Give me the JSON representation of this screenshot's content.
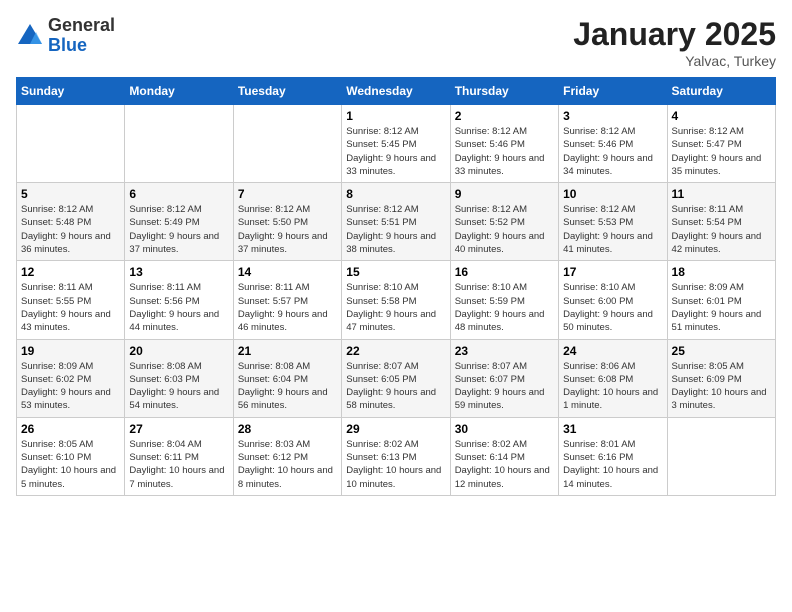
{
  "logo": {
    "general": "General",
    "blue": "Blue"
  },
  "header": {
    "month": "January 2025",
    "location": "Yalvac, Turkey"
  },
  "days_of_week": [
    "Sunday",
    "Monday",
    "Tuesday",
    "Wednesday",
    "Thursday",
    "Friday",
    "Saturday"
  ],
  "weeks": [
    [
      {
        "day": "",
        "sunrise": "",
        "sunset": "",
        "daylight": ""
      },
      {
        "day": "",
        "sunrise": "",
        "sunset": "",
        "daylight": ""
      },
      {
        "day": "",
        "sunrise": "",
        "sunset": "",
        "daylight": ""
      },
      {
        "day": "1",
        "sunrise": "Sunrise: 8:12 AM",
        "sunset": "Sunset: 5:45 PM",
        "daylight": "Daylight: 9 hours and 33 minutes."
      },
      {
        "day": "2",
        "sunrise": "Sunrise: 8:12 AM",
        "sunset": "Sunset: 5:46 PM",
        "daylight": "Daylight: 9 hours and 33 minutes."
      },
      {
        "day": "3",
        "sunrise": "Sunrise: 8:12 AM",
        "sunset": "Sunset: 5:46 PM",
        "daylight": "Daylight: 9 hours and 34 minutes."
      },
      {
        "day": "4",
        "sunrise": "Sunrise: 8:12 AM",
        "sunset": "Sunset: 5:47 PM",
        "daylight": "Daylight: 9 hours and 35 minutes."
      }
    ],
    [
      {
        "day": "5",
        "sunrise": "Sunrise: 8:12 AM",
        "sunset": "Sunset: 5:48 PM",
        "daylight": "Daylight: 9 hours and 36 minutes."
      },
      {
        "day": "6",
        "sunrise": "Sunrise: 8:12 AM",
        "sunset": "Sunset: 5:49 PM",
        "daylight": "Daylight: 9 hours and 37 minutes."
      },
      {
        "day": "7",
        "sunrise": "Sunrise: 8:12 AM",
        "sunset": "Sunset: 5:50 PM",
        "daylight": "Daylight: 9 hours and 37 minutes."
      },
      {
        "day": "8",
        "sunrise": "Sunrise: 8:12 AM",
        "sunset": "Sunset: 5:51 PM",
        "daylight": "Daylight: 9 hours and 38 minutes."
      },
      {
        "day": "9",
        "sunrise": "Sunrise: 8:12 AM",
        "sunset": "Sunset: 5:52 PM",
        "daylight": "Daylight: 9 hours and 40 minutes."
      },
      {
        "day": "10",
        "sunrise": "Sunrise: 8:12 AM",
        "sunset": "Sunset: 5:53 PM",
        "daylight": "Daylight: 9 hours and 41 minutes."
      },
      {
        "day": "11",
        "sunrise": "Sunrise: 8:11 AM",
        "sunset": "Sunset: 5:54 PM",
        "daylight": "Daylight: 9 hours and 42 minutes."
      }
    ],
    [
      {
        "day": "12",
        "sunrise": "Sunrise: 8:11 AM",
        "sunset": "Sunset: 5:55 PM",
        "daylight": "Daylight: 9 hours and 43 minutes."
      },
      {
        "day": "13",
        "sunrise": "Sunrise: 8:11 AM",
        "sunset": "Sunset: 5:56 PM",
        "daylight": "Daylight: 9 hours and 44 minutes."
      },
      {
        "day": "14",
        "sunrise": "Sunrise: 8:11 AM",
        "sunset": "Sunset: 5:57 PM",
        "daylight": "Daylight: 9 hours and 46 minutes."
      },
      {
        "day": "15",
        "sunrise": "Sunrise: 8:10 AM",
        "sunset": "Sunset: 5:58 PM",
        "daylight": "Daylight: 9 hours and 47 minutes."
      },
      {
        "day": "16",
        "sunrise": "Sunrise: 8:10 AM",
        "sunset": "Sunset: 5:59 PM",
        "daylight": "Daylight: 9 hours and 48 minutes."
      },
      {
        "day": "17",
        "sunrise": "Sunrise: 8:10 AM",
        "sunset": "Sunset: 6:00 PM",
        "daylight": "Daylight: 9 hours and 50 minutes."
      },
      {
        "day": "18",
        "sunrise": "Sunrise: 8:09 AM",
        "sunset": "Sunset: 6:01 PM",
        "daylight": "Daylight: 9 hours and 51 minutes."
      }
    ],
    [
      {
        "day": "19",
        "sunrise": "Sunrise: 8:09 AM",
        "sunset": "Sunset: 6:02 PM",
        "daylight": "Daylight: 9 hours and 53 minutes."
      },
      {
        "day": "20",
        "sunrise": "Sunrise: 8:08 AM",
        "sunset": "Sunset: 6:03 PM",
        "daylight": "Daylight: 9 hours and 54 minutes."
      },
      {
        "day": "21",
        "sunrise": "Sunrise: 8:08 AM",
        "sunset": "Sunset: 6:04 PM",
        "daylight": "Daylight: 9 hours and 56 minutes."
      },
      {
        "day": "22",
        "sunrise": "Sunrise: 8:07 AM",
        "sunset": "Sunset: 6:05 PM",
        "daylight": "Daylight: 9 hours and 58 minutes."
      },
      {
        "day": "23",
        "sunrise": "Sunrise: 8:07 AM",
        "sunset": "Sunset: 6:07 PM",
        "daylight": "Daylight: 9 hours and 59 minutes."
      },
      {
        "day": "24",
        "sunrise": "Sunrise: 8:06 AM",
        "sunset": "Sunset: 6:08 PM",
        "daylight": "Daylight: 10 hours and 1 minute."
      },
      {
        "day": "25",
        "sunrise": "Sunrise: 8:05 AM",
        "sunset": "Sunset: 6:09 PM",
        "daylight": "Daylight: 10 hours and 3 minutes."
      }
    ],
    [
      {
        "day": "26",
        "sunrise": "Sunrise: 8:05 AM",
        "sunset": "Sunset: 6:10 PM",
        "daylight": "Daylight: 10 hours and 5 minutes."
      },
      {
        "day": "27",
        "sunrise": "Sunrise: 8:04 AM",
        "sunset": "Sunset: 6:11 PM",
        "daylight": "Daylight: 10 hours and 7 minutes."
      },
      {
        "day": "28",
        "sunrise": "Sunrise: 8:03 AM",
        "sunset": "Sunset: 6:12 PM",
        "daylight": "Daylight: 10 hours and 8 minutes."
      },
      {
        "day": "29",
        "sunrise": "Sunrise: 8:02 AM",
        "sunset": "Sunset: 6:13 PM",
        "daylight": "Daylight: 10 hours and 10 minutes."
      },
      {
        "day": "30",
        "sunrise": "Sunrise: 8:02 AM",
        "sunset": "Sunset: 6:14 PM",
        "daylight": "Daylight: 10 hours and 12 minutes."
      },
      {
        "day": "31",
        "sunrise": "Sunrise: 8:01 AM",
        "sunset": "Sunset: 6:16 PM",
        "daylight": "Daylight: 10 hours and 14 minutes."
      },
      {
        "day": "",
        "sunrise": "",
        "sunset": "",
        "daylight": ""
      }
    ]
  ]
}
